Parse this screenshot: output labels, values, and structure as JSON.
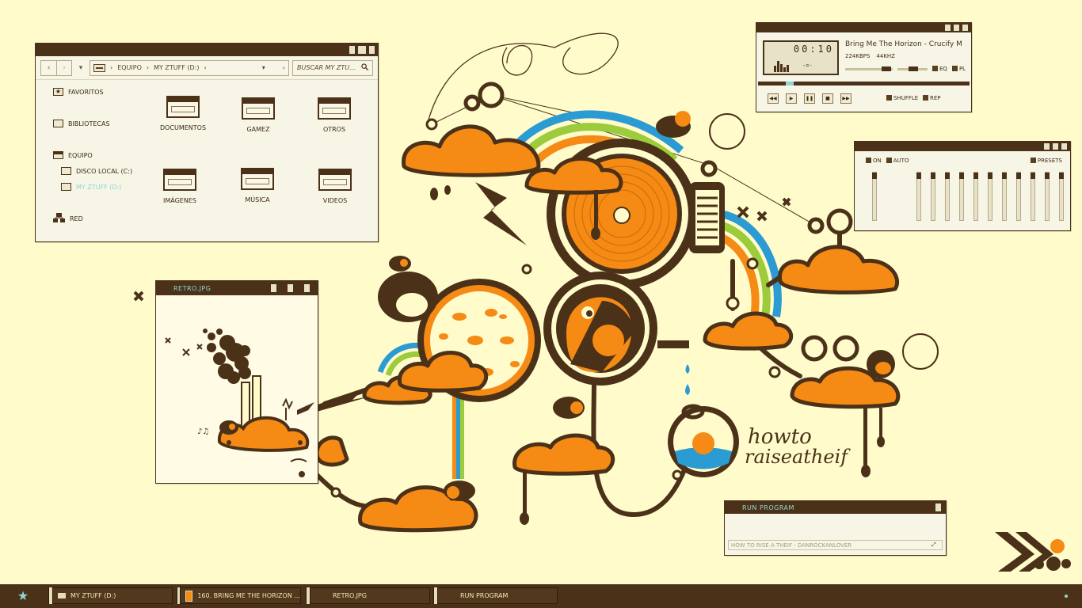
{
  "explorer": {
    "nav_back": "‹",
    "nav_forward": "›",
    "nav_recent": "▾",
    "address": [
      "EQUIPO",
      "MY ZTUFF (D:)"
    ],
    "address_dropdown": "▾",
    "address_go": "›",
    "search_placeholder": "BUSCAR MY ZTU...",
    "sidebar": [
      {
        "label": "FAVORITOS"
      },
      {
        "label": "BIBLIOTECAS"
      },
      {
        "label": "EQUIPO"
      },
      {
        "label": "DISCO LOCAL (C:)"
      },
      {
        "label": "MY ZTUFF (D:)"
      },
      {
        "label": "RED"
      }
    ],
    "folders": [
      "DOCUMENTOS",
      "GAMEZ",
      "OTROS",
      "IMÁGENES",
      "MÚSICA",
      "VIDEOS"
    ]
  },
  "player": {
    "time": "00:10",
    "track": "Bring Me The Horizon - Crucify M",
    "bitrate": "224KBPS",
    "samplerate": "44KHZ",
    "eq_label": "EQ",
    "pl_label": "PL",
    "shuffle_label": "SHUFFLE",
    "rep_label": "REP",
    "progress_fraction": 0.13
  },
  "equalizer": {
    "on_label": "ON",
    "auto_label": "AUTO",
    "presets_label": "PRESETS",
    "band_count": 12
  },
  "viewer": {
    "title": "RETRO.JPG"
  },
  "artwork": {
    "text_line1": "howto",
    "text_line2": "raiseatheif"
  },
  "run": {
    "title": "RUN PROGRAM",
    "input_value": "HOW TO RISE A THEIF - DANROCKANLOVER"
  },
  "taskbar": {
    "start_icon": "star-icon",
    "tasks": [
      "MY ZTUFF (D:)",
      "160. BRING ME THE HORIZON ...",
      "RETRO.JPG",
      "RUN PROGRAM"
    ]
  },
  "colors": {
    "background": "#fffbcb",
    "brown": "#4a3118",
    "orange": "#f58a14",
    "cyan": "#8ed7d6",
    "blue": "#2b9bd3",
    "green": "#9ccb3b"
  }
}
